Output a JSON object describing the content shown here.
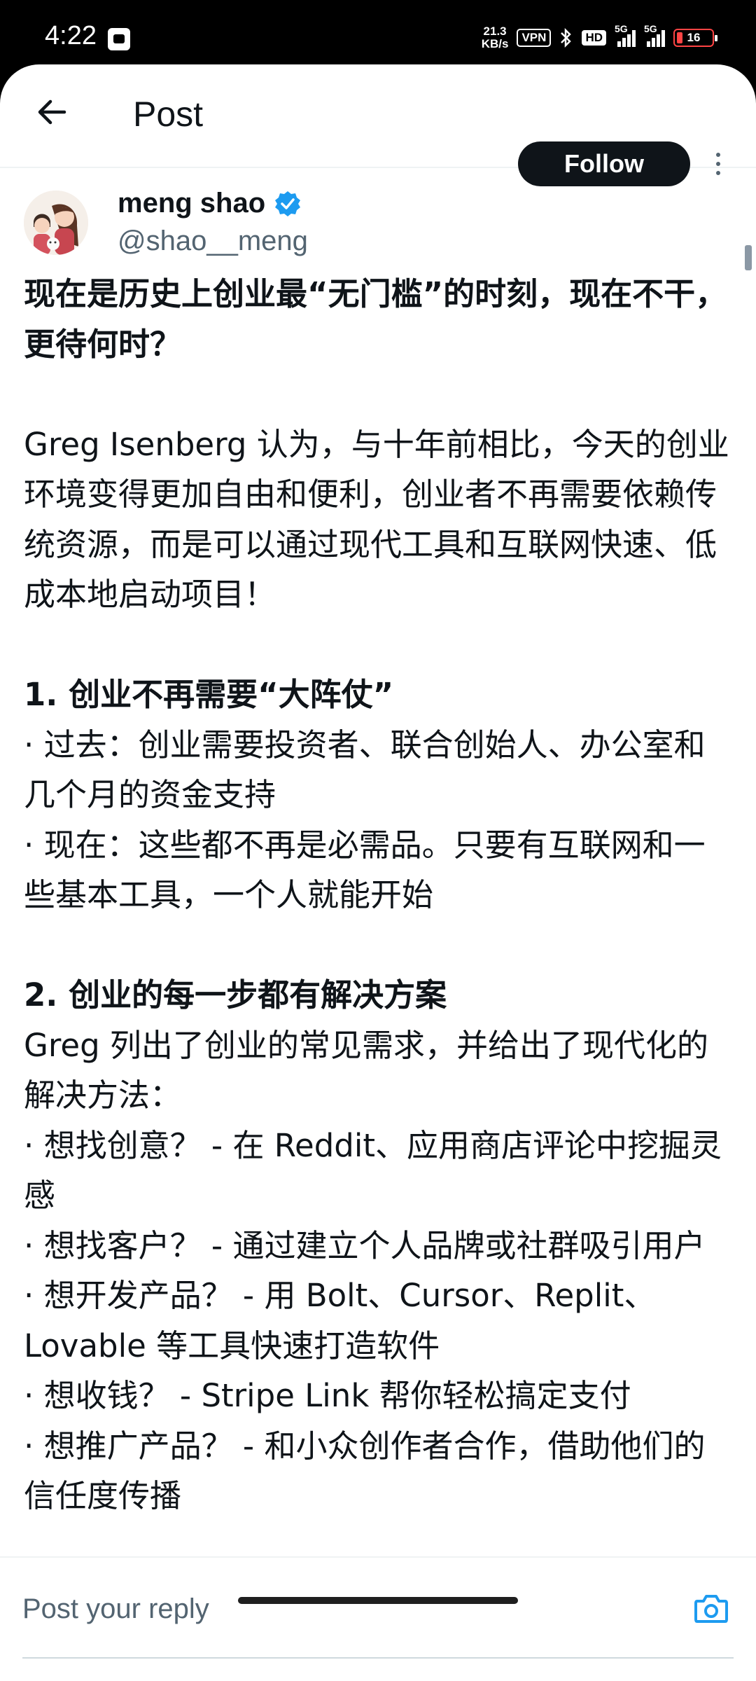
{
  "status_bar": {
    "time": "4:22",
    "net_speed_value": "21.3",
    "net_speed_unit": "KB/s",
    "vpn": "VPN",
    "hd": "HD",
    "signal1_label": "5G",
    "signal2_label": "5G",
    "battery": "16"
  },
  "header": {
    "back_icon": "arrow-left-icon",
    "title": "Post"
  },
  "author": {
    "display_name": "meng shao",
    "handle": "@shao__meng",
    "verified": true,
    "follow_label": "Follow"
  },
  "post": {
    "title": "现在是历史上创业最“无门槛”的时刻，现在不干，更待何时？",
    "intro": "Greg Isenberg 认为，与十年前相比，今天的创业环境变得更加自由和便利，创业者不再需要依赖传统资源，而是可以通过现代工具和互联网快速、低成本地启动项目！",
    "section1": {
      "heading": "1. 创业不再需要“大阵仗”",
      "items": [
        "· 过去：创业需要投资者、联合创始人、办公室和几个月的资金支持",
        "· 现在：这些都不再是必需品。只要有互联网和一些基本工具，一个人就能开始"
      ]
    },
    "section2": {
      "heading": "2. 创业的每一步都有解决方案",
      "intro": "Greg 列出了创业的常见需求，并给出了现代化的解决方法：",
      "items": [
        "· 想找创意？ - 在 Reddit、应用商店评论中挖掘灵感",
        "· 想找客户？ - 通过建立个人品牌或社群吸引用户",
        "· 想开发产品？ - 用 Bolt、Cursor、Replit、Lovable 等工具快速打造软件",
        "· 想收钱？ - Stripe Link 帮你轻松搞定支付",
        "· 想推广产品？ - 和小众创作者合作，借助他们的信任度传播"
      ]
    }
  },
  "reply": {
    "placeholder": "Post your reply",
    "camera_icon": "camera-icon"
  },
  "colors": {
    "text": "#0f1419",
    "secondary": "#536471",
    "verified": "#1d9bf0",
    "follow_bg": "#0f1419"
  }
}
